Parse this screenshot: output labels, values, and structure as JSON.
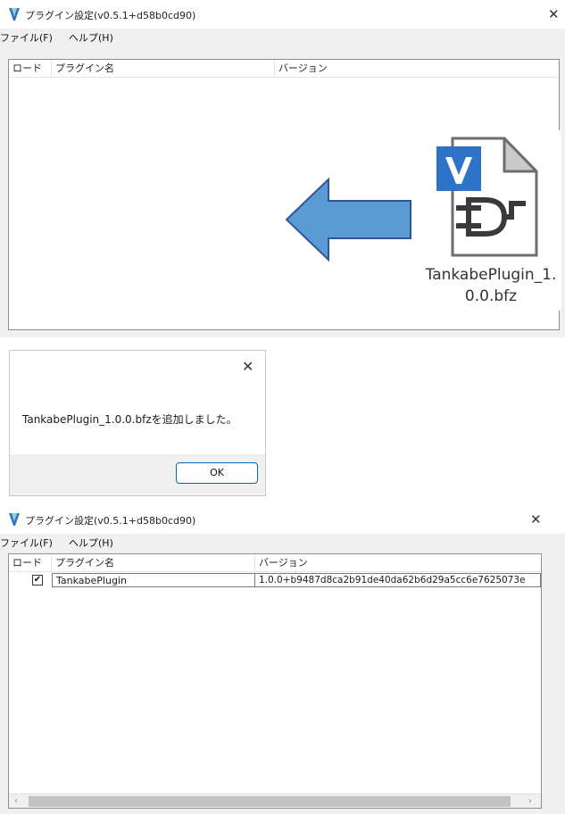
{
  "window1": {
    "title": "プラグイン設定(v0.5.1+d58b0cd90)",
    "menu": [
      "ファイル(F)",
      "ヘルプ(H)"
    ],
    "columns": [
      "ロード",
      "プラグイン名",
      "バージョン"
    ],
    "file_label_line1": "TankabePlugin_1.",
    "file_label_line2": "0.0.bfz"
  },
  "message_box": {
    "text": "TankabePlugin_1.0.0.bfzを追加しました。",
    "ok_label": "OK"
  },
  "window2": {
    "title": "プラグイン設定(v0.5.1+d58b0cd90)",
    "menu": [
      "ファイル(F)",
      "ヘルプ(H)"
    ],
    "columns": [
      "ロード",
      "プラグイン名",
      "バージョン"
    ],
    "rows": [
      {
        "loaded": true,
        "name": "TankabePlugin",
        "version": "1.0.0+b9487d8ca2b91de40da62b6d29a5cc6e7625073e"
      }
    ]
  },
  "colors": {
    "arrow_fill": "#5b9bd5",
    "arrow_stroke": "#2f5597",
    "logo_blue": "#2f73c9",
    "focus_blue": "#0067c0"
  },
  "icons": {
    "app": "app-logo-icon",
    "close": "close-icon",
    "file": "plugin-file-icon",
    "arrow": "drop-arrow-icon"
  }
}
